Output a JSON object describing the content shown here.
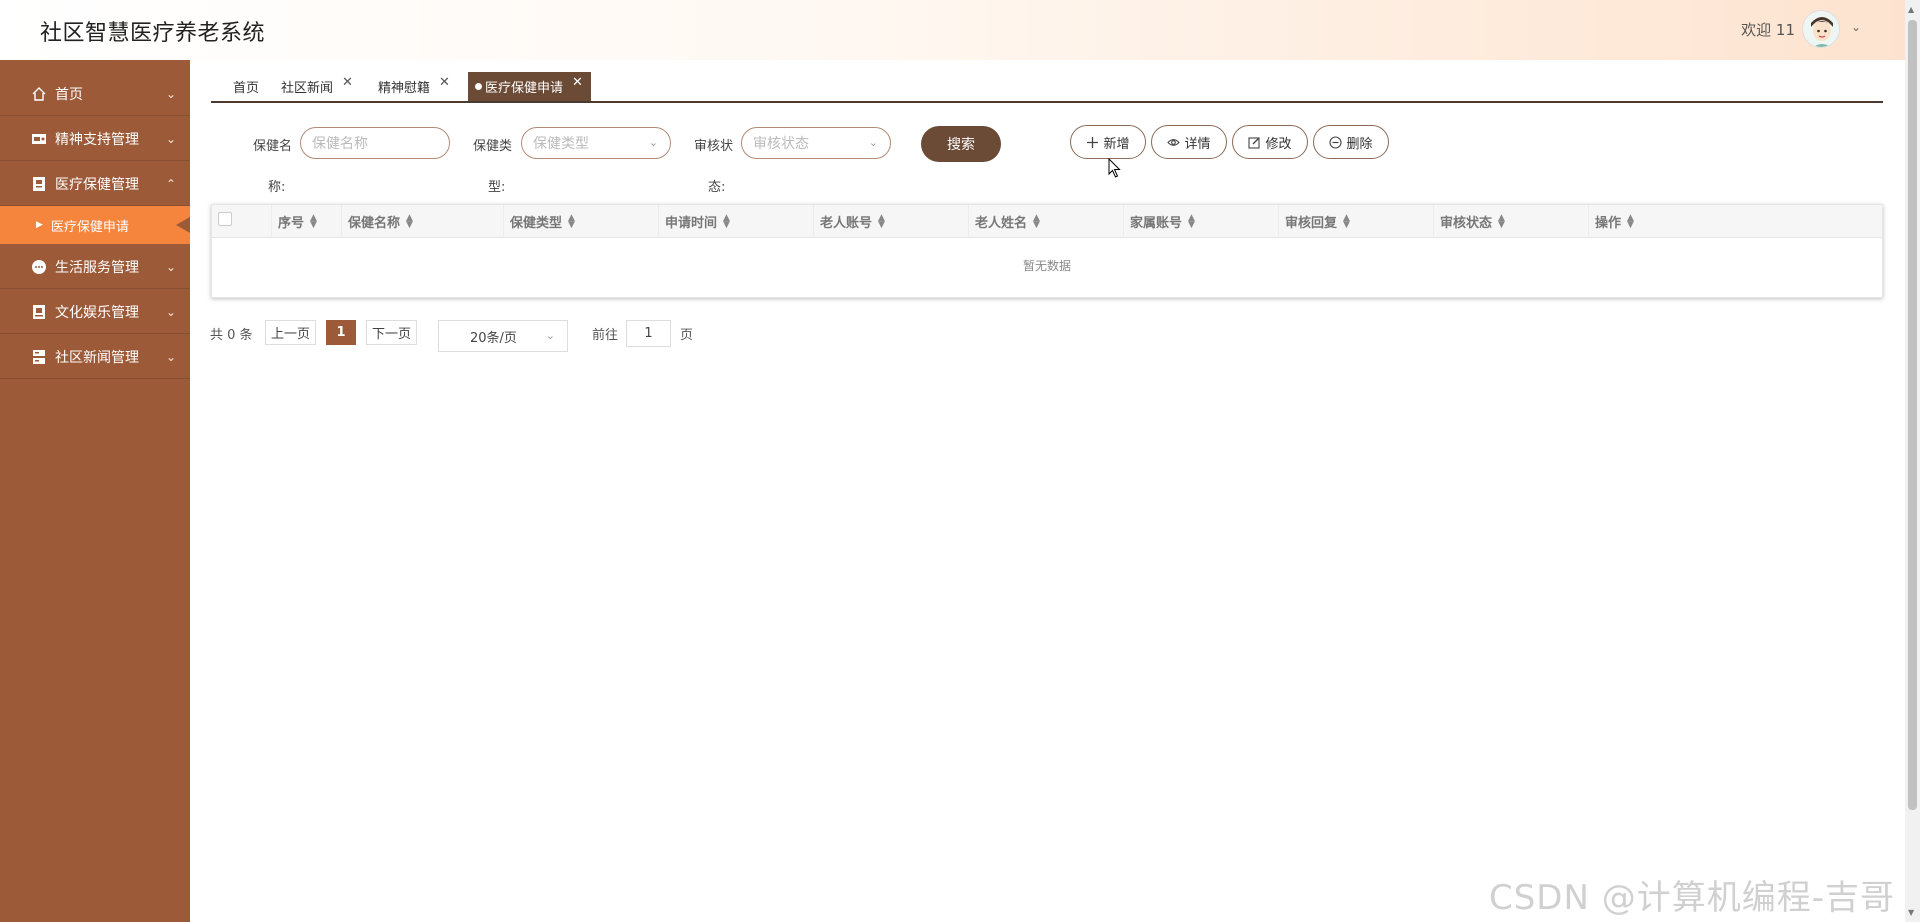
{
  "header": {
    "title": "社区智慧医疗养老系统",
    "welcome": "欢迎 11"
  },
  "sidebar": {
    "items": [
      {
        "label": "首页",
        "icon": "home-icon"
      },
      {
        "label": "精神支持管理",
        "icon": "support-icon"
      },
      {
        "label": "医疗保健管理",
        "icon": "medical-icon",
        "open": true
      },
      {
        "label": "生活服务管理",
        "icon": "service-icon"
      },
      {
        "label": "文化娱乐管理",
        "icon": "culture-icon"
      },
      {
        "label": "社区新闻管理",
        "icon": "news-icon"
      }
    ],
    "sub_item": "医疗保健申请"
  },
  "tabs": [
    {
      "label": "首页"
    },
    {
      "label": "社区新闻"
    },
    {
      "label": "精神慰籍"
    },
    {
      "label": "医疗保健申请",
      "active": true
    }
  ],
  "search": {
    "name_label_1": "保健名",
    "name_label_2": "称:",
    "name_placeholder": "保健名称",
    "type_label_1": "保健类",
    "type_label_2": "型:",
    "type_placeholder": "保健类型",
    "status_label_1": "审核状",
    "status_label_2": "态:",
    "status_placeholder": "审核状态",
    "search_button": "搜索"
  },
  "actions": {
    "add": "新增",
    "detail": "详情",
    "edit": "修改",
    "delete": "删除"
  },
  "table": {
    "columns": [
      "序号",
      "保健名称",
      "保健类型",
      "申请时间",
      "老人账号",
      "老人姓名",
      "家属账号",
      "审核回复",
      "审核状态",
      "操作"
    ],
    "empty_text": "暂无数据"
  },
  "pagination": {
    "total": "共 0 条",
    "prev": "上一页",
    "current": "1",
    "next": "下一页",
    "page_size": "20条/页",
    "goto_label": "前往",
    "goto_value": "1",
    "page_suffix": "页"
  },
  "watermark": "CSDN @计算机编程-吉哥",
  "colors": {
    "sidebar": "#9c5a38",
    "sidebar_active": "#f5843d",
    "primary_dark": "#6b4a36"
  }
}
